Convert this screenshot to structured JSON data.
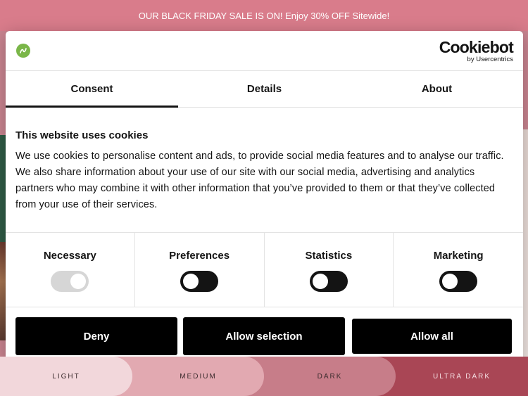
{
  "banner": {
    "text": "OUR BLACK FRIDAY SALE IS ON! Enjoy 30% OFF Sitewide!"
  },
  "shades": [
    "LIGHT",
    "MEDIUM",
    "DARK",
    "ULTRA DARK"
  ],
  "dialog": {
    "cookiebot_logo": {
      "wordmark": "Cookiebot",
      "subline": "by Usercentrics"
    },
    "tabs": [
      {
        "label": "Consent",
        "active": true
      },
      {
        "label": "Details",
        "active": false
      },
      {
        "label": "About",
        "active": false
      }
    ],
    "heading": "This website uses cookies",
    "body": "We use cookies to personalise content and ads, to provide social media features and to analyse our traffic. We also share information about your use of our site with our social media, advertising and analytics partners who may combine it with other information that you’ve provided to them or that they’ve collected from your use of their services.",
    "categories": [
      {
        "label": "Necessary",
        "enabled": true,
        "locked": true
      },
      {
        "label": "Preferences",
        "enabled": false,
        "locked": false
      },
      {
        "label": "Statistics",
        "enabled": false,
        "locked": false
      },
      {
        "label": "Marketing",
        "enabled": false,
        "locked": false
      }
    ],
    "buttons": {
      "deny": "Deny",
      "allow_selection": "Allow selection",
      "allow_all": "Allow all"
    }
  },
  "colors": {
    "banner_bg": "#d97c8b",
    "dialog_button_bg": "#000000",
    "toggle_off": "#141414",
    "toggle_locked": "#d6d6d6",
    "brand_logo": "#7ab648"
  }
}
